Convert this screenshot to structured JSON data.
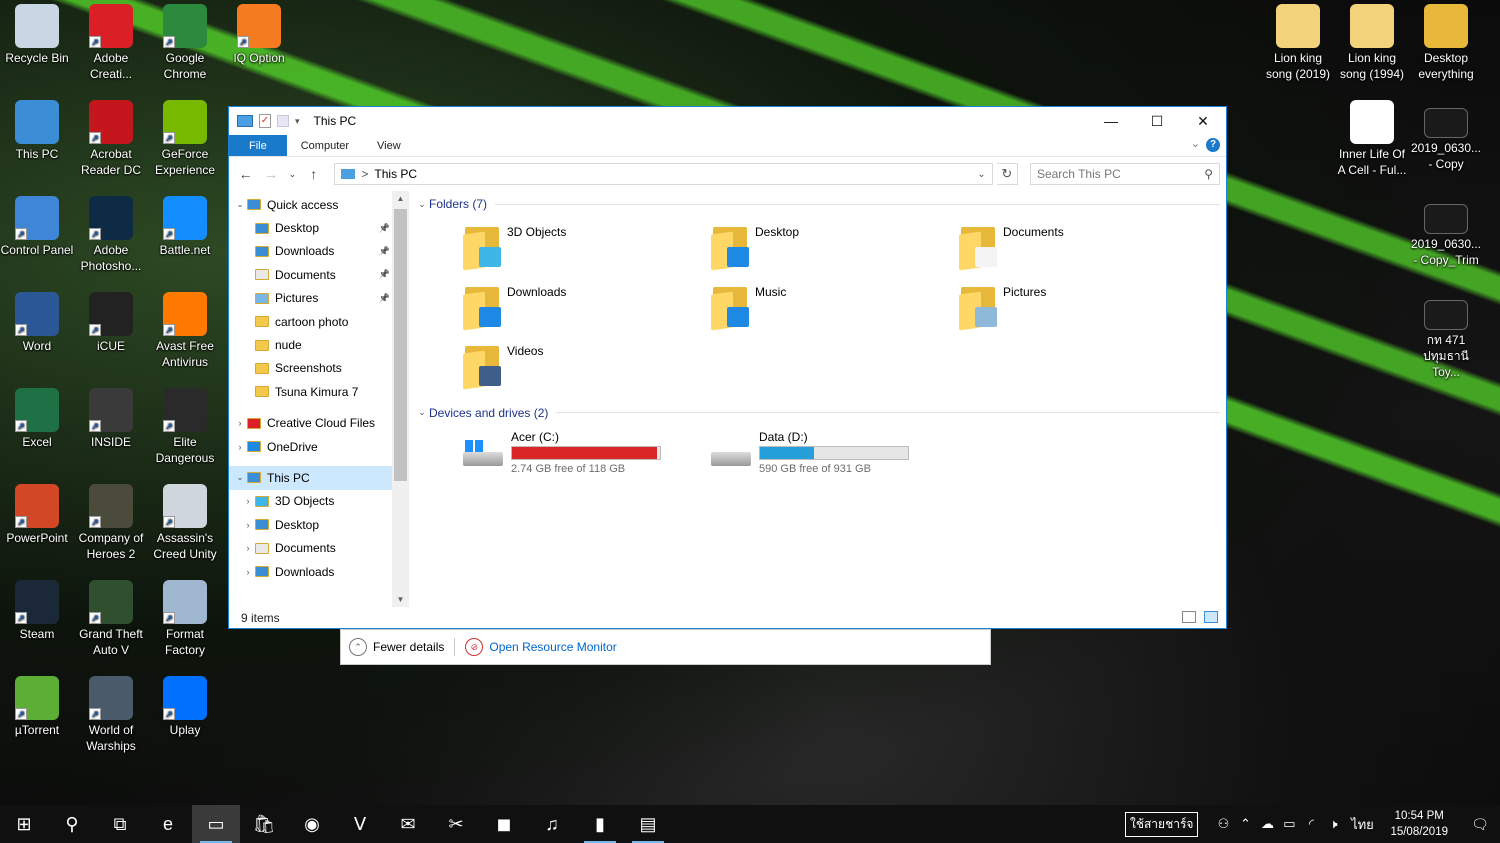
{
  "desktop": {
    "left_icons": [
      {
        "label": "Recycle Bin",
        "icon": "recycle-bin-icon",
        "color": "#c9d6e3"
      },
      {
        "label": "Adobe Creati...",
        "icon": "adobe-cc-icon",
        "color": "#da1f26"
      },
      {
        "label": "Google Chrome",
        "icon": "chrome-icon",
        "color": "#2b8a3e"
      },
      {
        "label": "IQ Option",
        "icon": "iq-option-icon",
        "color": "#f47b20"
      },
      {
        "label": "This PC",
        "icon": "this-pc-icon",
        "color": "#3b8ed5"
      },
      {
        "label": "Acrobat Reader DC",
        "icon": "acrobat-icon",
        "color": "#c4161c"
      },
      {
        "label": "GeForce Experience",
        "icon": "geforce-icon",
        "color": "#76b900"
      },
      {
        "label": "Control Panel",
        "icon": "control-panel-icon",
        "color": "#3f87d6"
      },
      {
        "label": "Adobe Photosho...",
        "icon": "photoshop-icon",
        "color": "#0d2b45"
      },
      {
        "label": "Battle.net",
        "icon": "battlenet-icon",
        "color": "#148eff"
      },
      {
        "label": "Word",
        "icon": "word-icon",
        "color": "#2b5797"
      },
      {
        "label": "iCUE",
        "icon": "icue-icon",
        "color": "#222222"
      },
      {
        "label": "Avast Free Antivirus",
        "icon": "avast-icon",
        "color": "#ff7800"
      },
      {
        "label": "Excel",
        "icon": "excel-icon",
        "color": "#1e7145"
      },
      {
        "label": "INSIDE",
        "icon": "inside-icon",
        "color": "#3a3a3a"
      },
      {
        "label": "Elite Dangerous",
        "icon": "elite-icon",
        "color": "#2a2a2a"
      },
      {
        "label": "PowerPoint",
        "icon": "powerpoint-icon",
        "color": "#d24726"
      },
      {
        "label": "Company of Heroes 2",
        "icon": "coh2-icon",
        "color": "#4b4b3c"
      },
      {
        "label": "Assassin's Creed Unity",
        "icon": "ac-unity-icon",
        "color": "#cfd6dd"
      },
      {
        "label": "Steam",
        "icon": "steam-icon",
        "color": "#1b2838"
      },
      {
        "label": "Grand Theft Auto V",
        "icon": "gta-icon",
        "color": "#2f4f2f"
      },
      {
        "label": "Format Factory",
        "icon": "format-factory-icon",
        "color": "#9fb8d0"
      },
      {
        "label": "µTorrent",
        "icon": "utorrent-icon",
        "color": "#5dae34"
      },
      {
        "label": "World of Warships",
        "icon": "wows-icon",
        "color": "#4a5a6a"
      },
      {
        "label": "Uplay",
        "icon": "uplay-icon",
        "color": "#0070ff"
      }
    ],
    "right_icons": [
      {
        "label": "Lion king song (2019)",
        "icon": "audio-file-icon",
        "color": "#f2d27a"
      },
      {
        "label": "Lion king song (1994)",
        "icon": "audio-file-icon",
        "color": "#f2d27a"
      },
      {
        "label": "Desktop everything",
        "icon": "folder-icon",
        "color": "#e8b83a"
      },
      {
        "label": "Inner Life Of A Cell - Ful...",
        "icon": "media-file-icon",
        "color": "#ffffff"
      },
      {
        "label": "2019_0630... - Copy",
        "icon": "video-thumb-icon",
        "color": "#1a1a1a"
      },
      {
        "label": "2019_0630... - Copy_Trim",
        "icon": "video-thumb-icon",
        "color": "#1a1a1a"
      },
      {
        "label": "กท 471 ปทุมธานี Toy...",
        "icon": "video-thumb-icon",
        "color": "#1a1a1a"
      }
    ]
  },
  "explorer": {
    "title": "This PC",
    "ribbon_tabs": [
      "File",
      "Computer",
      "View"
    ],
    "help_label": "?",
    "address": {
      "breadcrumb": "This PC",
      "separator": ">"
    },
    "search_placeholder": "Search This PC",
    "nav_pane": [
      {
        "label": "Quick access",
        "level": 0,
        "chevron": "⌄",
        "color": "#3b8ed5",
        "pinned": false
      },
      {
        "label": "Desktop",
        "level": 1,
        "chevron": "",
        "color": "#3b8ed5",
        "pinned": true
      },
      {
        "label": "Downloads",
        "level": 1,
        "chevron": "",
        "color": "#3b8ed5",
        "pinned": true
      },
      {
        "label": "Documents",
        "level": 1,
        "chevron": "",
        "color": "#e9e9e9",
        "pinned": true
      },
      {
        "label": "Pictures",
        "level": 1,
        "chevron": "",
        "color": "#7ab6e5",
        "pinned": true
      },
      {
        "label": "cartoon photo",
        "level": 1,
        "chevron": "",
        "color": "#f2c94c",
        "pinned": false
      },
      {
        "label": "nude",
        "level": 1,
        "chevron": "",
        "color": "#f2c94c",
        "pinned": false
      },
      {
        "label": "Screenshots",
        "level": 1,
        "chevron": "",
        "color": "#f2c94c",
        "pinned": false
      },
      {
        "label": "Tsuna Kimura 7",
        "level": 1,
        "chevron": "",
        "color": "#f2c94c",
        "pinned": false
      },
      {
        "label": "Creative Cloud Files",
        "level": 0,
        "chevron": "›",
        "color": "#da1f26",
        "pinned": false
      },
      {
        "label": "OneDrive",
        "level": 0,
        "chevron": "›",
        "color": "#1e88e5",
        "pinned": false
      },
      {
        "label": "This PC",
        "level": 0,
        "chevron": "⌄",
        "color": "#3b8ed5",
        "pinned": false,
        "selected": true
      },
      {
        "label": "3D Objects",
        "level": 1,
        "chevron": "›",
        "color": "#3fb6e8",
        "pinned": false
      },
      {
        "label": "Desktop",
        "level": 1,
        "chevron": "›",
        "color": "#3b8ed5",
        "pinned": false
      },
      {
        "label": "Documents",
        "level": 1,
        "chevron": "›",
        "color": "#e9e9e9",
        "pinned": false
      },
      {
        "label": "Downloads",
        "level": 1,
        "chevron": "›",
        "color": "#3b8ed5",
        "pinned": false
      }
    ],
    "folders_header": "Folders (7)",
    "folders": [
      {
        "name": "3D Objects",
        "overlay": "#3fb6e8"
      },
      {
        "name": "Desktop",
        "overlay": "#1e88e5"
      },
      {
        "name": "Documents",
        "overlay": "#f4f4f4"
      },
      {
        "name": "Downloads",
        "overlay": "#1e88e5"
      },
      {
        "name": "Music",
        "overlay": "#1e88e5"
      },
      {
        "name": "Pictures",
        "overlay": "#8fb9d9"
      },
      {
        "name": "Videos",
        "overlay": "#3d5f8a"
      }
    ],
    "drives_header": "Devices and drives (2)",
    "drives": [
      {
        "name": "Acer (C:)",
        "free_text": "2.74 GB free of 118 GB",
        "used_fraction": 0.977,
        "bar_color": "#da2626",
        "windows_logo": true
      },
      {
        "name": "Data (D:)",
        "free_text": "590 GB free of 931 GB",
        "used_fraction": 0.366,
        "bar_color": "#26a0da",
        "windows_logo": false
      }
    ],
    "status": "9 items"
  },
  "task_manager_strip": {
    "fewer_details": "Fewer details",
    "open_resource_monitor": "Open Resource Monitor"
  },
  "taskbar": {
    "apps": [
      {
        "name": "start-button",
        "glyph": "⊞",
        "state": ""
      },
      {
        "name": "search-icon",
        "glyph": "⚲",
        "state": ""
      },
      {
        "name": "task-view-icon",
        "glyph": "⧉",
        "state": ""
      },
      {
        "name": "edge-icon",
        "glyph": "e",
        "state": ""
      },
      {
        "name": "file-explorer-icon",
        "glyph": "▭",
        "state": "active"
      },
      {
        "name": "store-icon",
        "glyph": "🛍",
        "state": ""
      },
      {
        "name": "firefox-icon",
        "glyph": "◉",
        "state": ""
      },
      {
        "name": "predator-icon",
        "glyph": "ᐯ",
        "state": ""
      },
      {
        "name": "mail-icon",
        "glyph": "✉",
        "state": ""
      },
      {
        "name": "snipping-icon",
        "glyph": "✂",
        "state": ""
      },
      {
        "name": "line-icon",
        "glyph": "◼",
        "state": ""
      },
      {
        "name": "itunes-icon",
        "glyph": "♫",
        "state": ""
      },
      {
        "name": "iq-option-taskbar-icon",
        "glyph": "▮",
        "state": "run"
      },
      {
        "name": "task-manager-icon",
        "glyph": "▤",
        "state": "run"
      }
    ],
    "ime_label": "ใช้สายชาร์จ",
    "lang": "ไทย",
    "time": "10:54 PM",
    "date": "15/08/2019"
  }
}
